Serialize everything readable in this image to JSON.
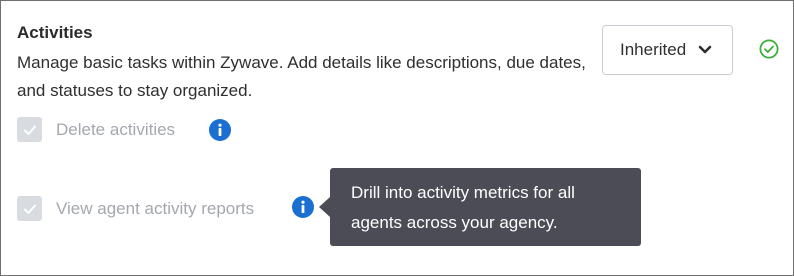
{
  "section": {
    "title": "Activities",
    "description": "Manage basic tasks within Zywave. Add details like descriptions, due dates, and statuses to stay organized."
  },
  "permission_level": {
    "selected": "Inherited",
    "status": "ok"
  },
  "permissions": [
    {
      "label": "Delete activities",
      "checked": true,
      "disabled": true
    },
    {
      "label": "View agent activity reports",
      "checked": true,
      "disabled": true
    }
  ],
  "tooltip": {
    "text": "Drill into activity metrics for all agents across your agency."
  },
  "colors": {
    "info_blue": "#1a6fd0",
    "status_green": "#3cae3c",
    "tooltip_bg": "#4b4c56"
  },
  "icons": {
    "chevron": "chevron-down-icon",
    "status": "check-circle-icon",
    "info": "info-icon",
    "check": "checkmark-icon"
  }
}
